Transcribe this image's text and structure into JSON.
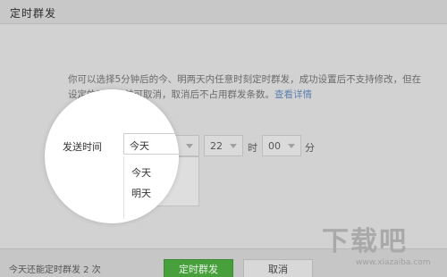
{
  "dialog": {
    "title": "定时群发",
    "description": "你可以选择5分钟后的今、明两天内任意时刻定时群发，成功设置后不支持修改，但在设定的时间之前可取消，取消后不占用群发条数。",
    "description_link": "查看详情"
  },
  "schedule": {
    "label": "发送时间",
    "day_value": "今天",
    "hour_value": "22",
    "hour_unit": "时",
    "minute_value": "00",
    "minute_unit": "分",
    "day_options": [
      "今天",
      "明天"
    ]
  },
  "footer": {
    "quota_text": "今天还能定时群发 2 次",
    "confirm_label": "定时群发",
    "cancel_label": "取消"
  },
  "watermark": {
    "main": "下载吧",
    "sub": "www.xiazaiba.com"
  },
  "colors": {
    "primary_button": "#47a03c",
    "link": "#5c7fb0"
  }
}
